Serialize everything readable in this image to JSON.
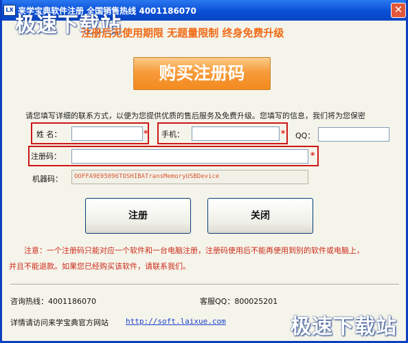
{
  "window": {
    "title": "来学宝典软件注册  全国销售热线  4001186070",
    "icon_text": "LX",
    "close_symbol": "✕",
    "colors": {
      "title_bar": "#0a4fd6",
      "accent": "#f06a16",
      "warning": "#cc2a1a",
      "required_box": "#cc1616"
    }
  },
  "watermarks": {
    "top": "极速下载站",
    "bottom": "极速下载站"
  },
  "slogan": "注册后无使用期限  无题量限制  终身免费升级",
  "buy_button_label": "购买注册码",
  "intro": "请您填写详细的联系方式，以便为您提供优质的售后服务及免费升级。您填写的信息，我们将为您保密",
  "form": {
    "name_label": "姓  名：",
    "name_value": "",
    "phone_label": "手机：",
    "phone_value": "",
    "qq_label": "QQ：",
    "qq_value": "",
    "regcode_label": "注册码：",
    "regcode_value": "",
    "machine_label": "机器码：",
    "machine_value": "OOFFA9E05096TOSHIBATransMemoryUSBDevice",
    "required_mark": "*"
  },
  "buttons": {
    "register": "注册",
    "close": "关闭"
  },
  "notes": {
    "line1": "注意：一个注册码只能对应一个软件和一台电脑注册，注册码使用后不能再使用到别的软件或电脑上，",
    "line2": "并且不能退款。如果您已经购买该软件，请联系我们。"
  },
  "footer": {
    "hotline": "咨询热线：4001186070",
    "support_qq": "客服QQ：800025201",
    "visit_text": "详情请访问来学宝典官方网站",
    "website": "http://soft.laixue.com"
  }
}
